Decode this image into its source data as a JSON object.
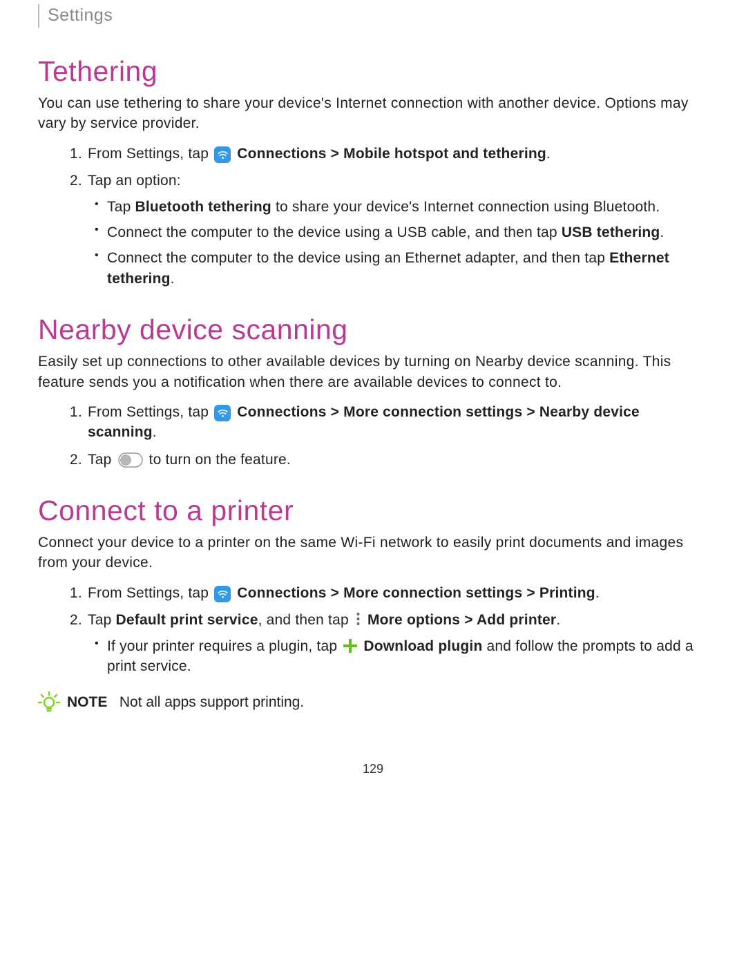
{
  "breadcrumb": "Settings",
  "sections": {
    "tethering": {
      "title": "Tethering",
      "intro": "You can use tethering to share your device's Internet connection with another device. Options may vary by service provider.",
      "step1_pre": "From Settings, tap ",
      "step1_bold1": "Connections",
      "sep": " > ",
      "step1_bold2": "Mobile hotspot and tethering",
      "period": ".",
      "step2": "Tap an option:",
      "bullet1_pre": "Tap ",
      "bullet1_bold": "Bluetooth tethering",
      "bullet1_post": " to share your device's Internet connection using Bluetooth.",
      "bullet2_pre": "Connect the computer to the device using a USB cable, and then tap ",
      "bullet2_bold": "USB tethering",
      "bullet3_pre": "Connect the computer to the device using an Ethernet adapter, and then tap ",
      "bullet3_bold": "Ethernet tethering"
    },
    "nearby": {
      "title": "Nearby device scanning",
      "intro": "Easily set up connections to other available devices by turning on Nearby device scanning. This feature sends you a notification when there are available devices to connect to.",
      "step1_pre": "From Settings, tap ",
      "step1_bold1": "Connections",
      "step1_bold2": "More connection settings",
      "step1_bold3": "Nearby device scanning",
      "step2_pre": "Tap ",
      "step2_post": " to turn on the feature."
    },
    "printer": {
      "title": "Connect to a printer",
      "intro": "Connect your device to a printer on the same Wi-Fi network to easily print documents and images from your device.",
      "step1_pre": "From Settings, tap ",
      "step1_bold1": "Connections",
      "step1_bold2": "More connection settings",
      "step1_bold3": "Printing",
      "step2_pre": "Tap ",
      "step2_bold1": "Default print service",
      "step2_mid": ", and then tap ",
      "step2_bold2": "More options",
      "step2_bold3": "Add printer",
      "bullet_pre": "If your printer requires a plugin, tap ",
      "bullet_bold": "Download plugin",
      "bullet_post": " and follow the prompts to add a print service.",
      "note_label": "NOTE",
      "note_text": "Not all apps support printing."
    }
  },
  "pageNumber": "129"
}
